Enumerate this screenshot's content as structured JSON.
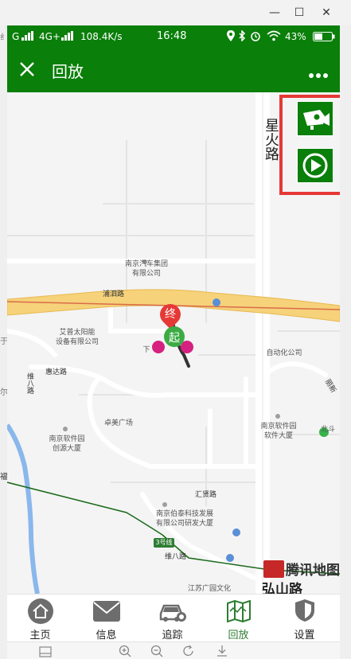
{
  "window": {
    "minimize_glyph": "—",
    "maximize_glyph": "☐",
    "close_glyph": "✕"
  },
  "status_bar": {
    "carrier_left": "G",
    "network": "4G+",
    "speed": "108.4K/s",
    "time": "16:48",
    "battery": "43%"
  },
  "app_bar": {
    "title": "回放",
    "close_icon": "close-icon",
    "more_icon": "more-icon"
  },
  "map": {
    "roads": {
      "pusi": "浦泗路",
      "huida": "惠达路",
      "weiba": "维八路",
      "weiba2": "维八路",
      "huixian": "汇贤路",
      "xinghuo": "星火路",
      "lijing": "丽新"
    },
    "pois": {
      "nanqi": [
        "南京汽车集团",
        "有限公司"
      ],
      "aipu": [
        "艾普太阳能",
        "设备有限公司"
      ],
      "zidonghua": "自动化公司",
      "zhuomei": "卓美广场",
      "ruanjian_chuangyuan": [
        "南京软件园",
        "创源大厦"
      ],
      "ruanjian_dasha": [
        "南京软件园",
        "软件大厦"
      ],
      "bota": [
        "南京伯泰科技发展",
        "有限公司研发大厦"
      ],
      "jiangsu": "江苏广园文化",
      "beidou": "北斗",
      "xiafu": "下",
      "line3": "3号线"
    },
    "markers": {
      "end_label": "终",
      "start_label": "起"
    },
    "watermark": "腾讯地图",
    "bottom_text": "弘山路",
    "edge_left_text": [
      "纟",
      "于",
      "尔",
      "福"
    ],
    "overlay_buttons": {
      "camera_icon": "camera-icon",
      "play_icon": "play-icon"
    }
  },
  "tabs": [
    {
      "label": "主页",
      "icon": "home-icon",
      "active": false
    },
    {
      "label": "信息",
      "icon": "mail-icon",
      "active": false
    },
    {
      "label": "追踪",
      "icon": "car-icon",
      "active": false
    },
    {
      "label": "回放",
      "icon": "map-icon",
      "active": true
    },
    {
      "label": "设置",
      "icon": "shield-icon",
      "active": false
    }
  ],
  "colors": {
    "brand_green": "#0a7f0a",
    "highlight_red": "#e53935",
    "tab_active": "#2e7d32"
  }
}
